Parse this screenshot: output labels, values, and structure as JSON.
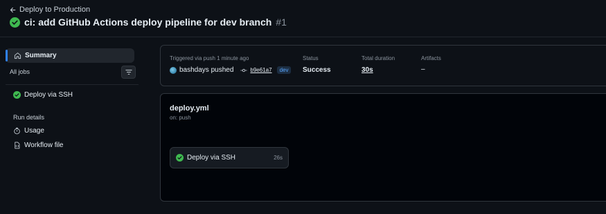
{
  "header": {
    "back_label": "Deploy to Production",
    "title": "ci: add GitHub Actions deploy pipeline for dev branch",
    "run_number": "#1"
  },
  "sidebar": {
    "summary_label": "Summary",
    "all_jobs_label": "All jobs",
    "jobs": [
      {
        "label": "Deploy via SSH",
        "status": "success"
      }
    ],
    "run_details_label": "Run details",
    "run_details_items": [
      {
        "label": "Usage",
        "icon": "stopwatch-icon"
      },
      {
        "label": "Workflow file",
        "icon": "file-code-icon"
      }
    ]
  },
  "summary": {
    "trigger_label": "Triggered via push 1 minute ago",
    "actor": "bashdays pushed",
    "commit_sha": "b9e61a7",
    "branch": "dev",
    "status_label": "Status",
    "status_value": "Success",
    "duration_label": "Total duration",
    "duration_value": "30s",
    "artifacts_label": "Artifacts",
    "artifacts_value": "–"
  },
  "workflow": {
    "file": "deploy.yml",
    "trigger": "on: push",
    "job": {
      "label": "Deploy via SSH",
      "duration": "26s",
      "status": "success"
    }
  },
  "colors": {
    "background": "#0d1117",
    "success": "#3fb950",
    "accent": "#2f81f7",
    "branch_badge_bg": "#1c2d41",
    "branch_badge_text": "#58a6ff"
  }
}
